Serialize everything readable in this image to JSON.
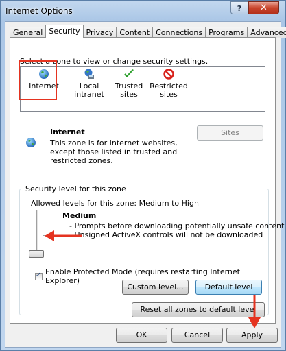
{
  "window": {
    "title": "Internet Options",
    "help_label": "?",
    "close_label": "✕"
  },
  "tabs": [
    {
      "label": "General",
      "active": false
    },
    {
      "label": "Security",
      "active": true
    },
    {
      "label": "Privacy",
      "active": false
    },
    {
      "label": "Content",
      "active": false
    },
    {
      "label": "Connections",
      "active": false
    },
    {
      "label": "Programs",
      "active": false
    },
    {
      "label": "Advanced",
      "active": false
    }
  ],
  "zones": {
    "prompt": "Select a zone to view or change security settings.",
    "items": [
      {
        "label_line1": "Internet",
        "label_line2": "",
        "icon": "globe-icon",
        "selected": true
      },
      {
        "label_line1": "Local",
        "label_line2": "intranet",
        "icon": "intranet-icon",
        "selected": false
      },
      {
        "label_line1": "Trusted",
        "label_line2": "sites",
        "icon": "checkmark-icon",
        "selected": false
      },
      {
        "label_line1": "Restricted",
        "label_line2": "sites",
        "icon": "no-entry-icon",
        "selected": false
      }
    ]
  },
  "zone_info": {
    "title": "Internet",
    "description": "This zone is for Internet websites, except those listed in trusted and restricted zones.",
    "sites_button": "Sites"
  },
  "security_level": {
    "group_label": "Security level for this zone",
    "allowed": "Allowed levels for this zone: Medium to High",
    "level_name": "Medium",
    "description_lines": [
      "- Prompts before downloading potentially unsafe content",
      "- Unsigned ActiveX controls will not be downloaded"
    ],
    "slider_level": "Medium",
    "protected_mode_label": "Enable Protected Mode (requires restarting Internet Explorer)",
    "protected_mode_checked": true,
    "custom_level_button": "Custom level...",
    "default_level_button": "Default level"
  },
  "reset_button": "Reset all zones to default level",
  "footer": {
    "ok": "OK",
    "cancel": "Cancel",
    "apply": "Apply"
  },
  "colors": {
    "annotation_red": "#e53320",
    "titlebar": "#aac6e6",
    "close_button": "#c9442c"
  }
}
